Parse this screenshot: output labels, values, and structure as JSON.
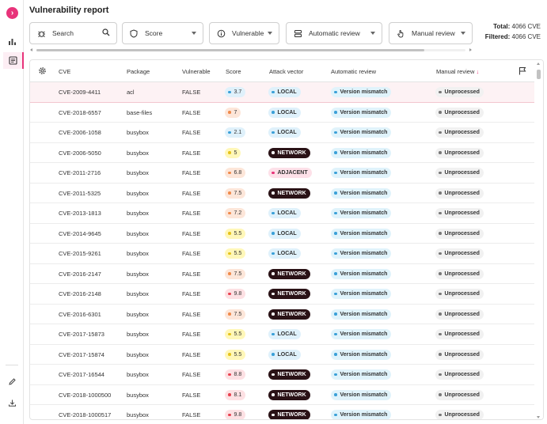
{
  "page_title": "Vulnerability report",
  "sidebar": {
    "toggle_icon": "chevron-right-icon",
    "items": [
      {
        "name": "chart-icon"
      },
      {
        "name": "report-icon"
      },
      {
        "name": "edit-icon"
      },
      {
        "name": "download-icon"
      }
    ]
  },
  "filters": {
    "search_placeholder": "Search",
    "score_label": "Score",
    "vulnerable_label": "Vulnerable",
    "automatic_review_label": "Automatic review",
    "manual_review_label": "Manual review"
  },
  "totals": {
    "total_label": "Total:",
    "total_value": "4066 CVE",
    "filtered_label": "Filtered:",
    "filtered_value": "4066 CVE"
  },
  "table": {
    "columns": {
      "cve": "CVE",
      "package": "Package",
      "vulnerable": "Vulnerable",
      "score": "Score",
      "attack_vector": "Attack vector",
      "automatic_review": "Automatic review",
      "manual_review": "Manual review",
      "manual_review_sort": "↓"
    },
    "rows": [
      {
        "cve": "CVE-2009-4411",
        "package": "acl",
        "vulnerable": "FALSE",
        "score": "3.7",
        "attack_vector": "LOCAL",
        "automatic_review": "Version mismatch",
        "manual_review": "Unprocessed"
      },
      {
        "cve": "CVE-2018-6557",
        "package": "base-files",
        "vulnerable": "FALSE",
        "score": "7",
        "attack_vector": "LOCAL",
        "automatic_review": "Version mismatch",
        "manual_review": "Unprocessed"
      },
      {
        "cve": "CVE-2006-1058",
        "package": "busybox",
        "vulnerable": "FALSE",
        "score": "2.1",
        "attack_vector": "LOCAL",
        "automatic_review": "Version mismatch",
        "manual_review": "Unprocessed"
      },
      {
        "cve": "CVE-2006-5050",
        "package": "busybox",
        "vulnerable": "FALSE",
        "score": "5",
        "attack_vector": "NETWORK",
        "automatic_review": "Version mismatch",
        "manual_review": "Unprocessed"
      },
      {
        "cve": "CVE-2011-2716",
        "package": "busybox",
        "vulnerable": "FALSE",
        "score": "6.8",
        "attack_vector": "ADJACENT",
        "automatic_review": "Version mismatch",
        "manual_review": "Unprocessed"
      },
      {
        "cve": "CVE-2011-5325",
        "package": "busybox",
        "vulnerable": "FALSE",
        "score": "7.5",
        "attack_vector": "NETWORK",
        "automatic_review": "Version mismatch",
        "manual_review": "Unprocessed"
      },
      {
        "cve": "CVE-2013-1813",
        "package": "busybox",
        "vulnerable": "FALSE",
        "score": "7.2",
        "attack_vector": "LOCAL",
        "automatic_review": "Version mismatch",
        "manual_review": "Unprocessed"
      },
      {
        "cve": "CVE-2014-9645",
        "package": "busybox",
        "vulnerable": "FALSE",
        "score": "5.5",
        "attack_vector": "LOCAL",
        "automatic_review": "Version mismatch",
        "manual_review": "Unprocessed"
      },
      {
        "cve": "CVE-2015-9261",
        "package": "busybox",
        "vulnerable": "FALSE",
        "score": "5.5",
        "attack_vector": "LOCAL",
        "automatic_review": "Version mismatch",
        "manual_review": "Unprocessed"
      },
      {
        "cve": "CVE-2016-2147",
        "package": "busybox",
        "vulnerable": "FALSE",
        "score": "7.5",
        "attack_vector": "NETWORK",
        "automatic_review": "Version mismatch",
        "manual_review": "Unprocessed"
      },
      {
        "cve": "CVE-2016-2148",
        "package": "busybox",
        "vulnerable": "FALSE",
        "score": "9.8",
        "attack_vector": "NETWORK",
        "automatic_review": "Version mismatch",
        "manual_review": "Unprocessed"
      },
      {
        "cve": "CVE-2016-6301",
        "package": "busybox",
        "vulnerable": "FALSE",
        "score": "7.5",
        "attack_vector": "NETWORK",
        "automatic_review": "Version mismatch",
        "manual_review": "Unprocessed"
      },
      {
        "cve": "CVE-2017-15873",
        "package": "busybox",
        "vulnerable": "FALSE",
        "score": "5.5",
        "attack_vector": "LOCAL",
        "automatic_review": "Version mismatch",
        "manual_review": "Unprocessed"
      },
      {
        "cve": "CVE-2017-15874",
        "package": "busybox",
        "vulnerable": "FALSE",
        "score": "5.5",
        "attack_vector": "LOCAL",
        "automatic_review": "Version mismatch",
        "manual_review": "Unprocessed"
      },
      {
        "cve": "CVE-2017-16544",
        "package": "busybox",
        "vulnerable": "FALSE",
        "score": "8.8",
        "attack_vector": "NETWORK",
        "automatic_review": "Version mismatch",
        "manual_review": "Unprocessed"
      },
      {
        "cve": "CVE-2018-1000500",
        "package": "busybox",
        "vulnerable": "FALSE",
        "score": "8.1",
        "attack_vector": "NETWORK",
        "automatic_review": "Version mismatch",
        "manual_review": "Unprocessed"
      },
      {
        "cve": "CVE-2018-1000517",
        "package": "busybox",
        "vulnerable": "FALSE",
        "score": "9.8",
        "attack_vector": "NETWORK",
        "automatic_review": "Version mismatch",
        "manual_review": "Unprocessed"
      }
    ]
  },
  "colors": {
    "accent": "#e8337a",
    "score_low_bg": "#dff1fb",
    "score_low_dot": "#3aa0d8",
    "score_medium_bg": "#fff7b8",
    "score_medium_dot": "#e6c21b",
    "score_high_bg": "#fde6d9",
    "score_high_dot": "#f08a4b",
    "score_critical_bg": "#fde0e3",
    "score_critical_dot": "#e8414f",
    "local_bg": "#dff1fb",
    "network_bg": "#2a1216",
    "adjacent_bg": "#fde0e8",
    "version_mismatch_bg": "#e0f3fb",
    "unprocessed_bg": "#f1f1f1"
  }
}
